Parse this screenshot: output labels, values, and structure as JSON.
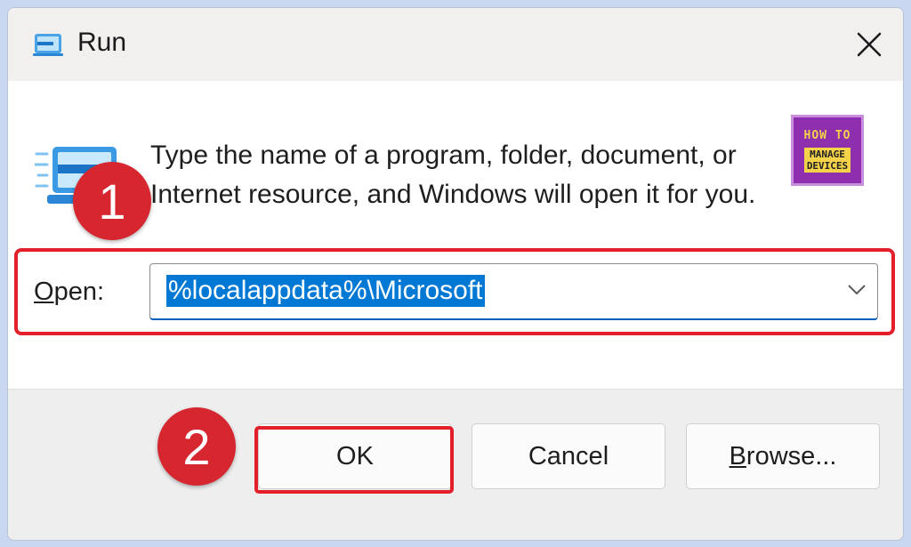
{
  "window": {
    "title": "Run"
  },
  "description": "Type the name of a program, folder, document, or Internet resource, and Windows will open it for you.",
  "logo": {
    "line1": "HOW TO",
    "line2a": "MANAGE",
    "line2b": "DEVICES"
  },
  "open": {
    "label_first": "O",
    "label_rest": "pen:",
    "value": "%localappdata%\\Microsoft"
  },
  "buttons": {
    "ok": "OK",
    "cancel": "Cancel",
    "browse_first": "B",
    "browse_rest": "rowse..."
  },
  "badges": {
    "step1": "1",
    "step2": "2"
  },
  "colors": {
    "highlight": "#e3202a",
    "selection": "#0078d4",
    "badge": "#d6262f",
    "logo_bg": "#8e2fae",
    "logo_accent": "#f4d34a"
  }
}
